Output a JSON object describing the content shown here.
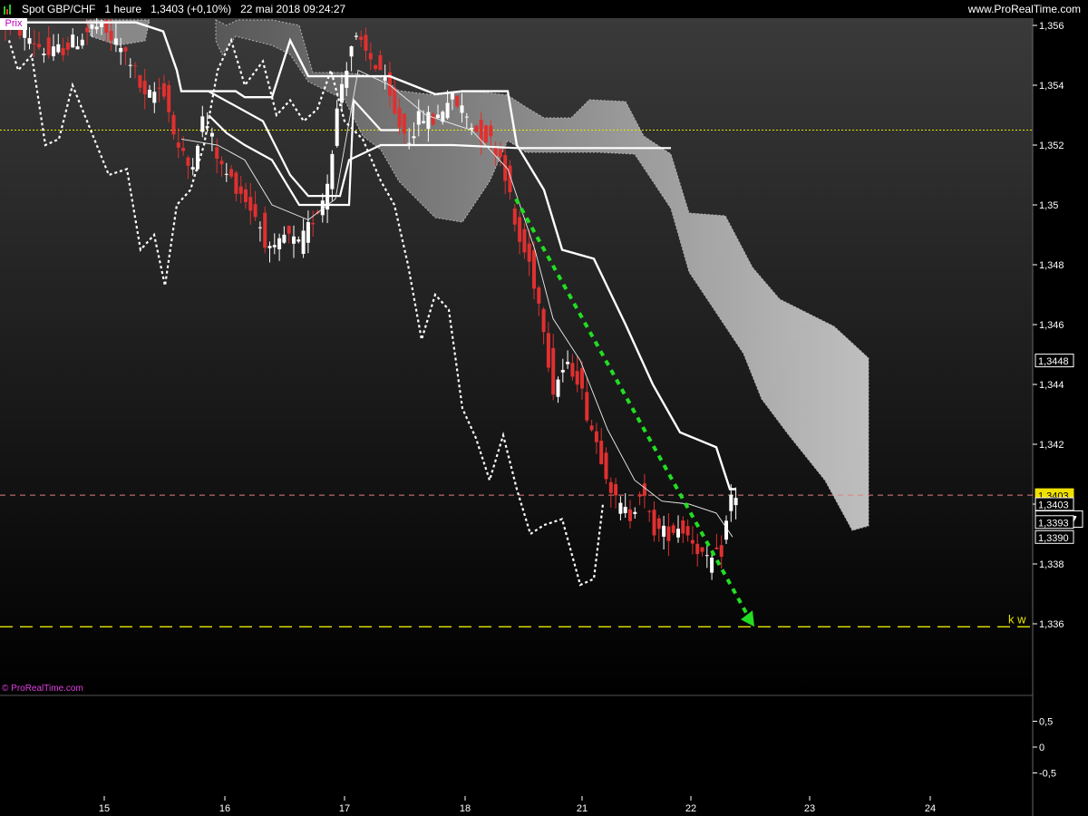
{
  "header": {
    "instrument": "Spot GBP/CHF",
    "timeframe": "1 heure",
    "quote": "1,3403 (+0,10%)",
    "datetime": "22 mai 2018 09:24:27",
    "site": "www.ProRealTime.com"
  },
  "price_tag": "Prix",
  "watermark": "© ProRealTime.com",
  "colors": {
    "up": "#ffffff",
    "down": "#e03030",
    "trend_arrow": "#22dd22",
    "ref_line": "#e6e600",
    "last_price_line": "#e08080",
    "cloud": "#9a9a9a"
  },
  "chart_data": {
    "type": "candlestick",
    "y_axis": {
      "ticks": [
        "1,356",
        "1,354",
        "1,352",
        "1,35",
        "1,348",
        "1,346",
        "1,344",
        "1,342",
        "1,34",
        "1,338",
        "1,336"
      ],
      "tick_values": [
        1.356,
        1.354,
        1.352,
        1.35,
        1.348,
        1.346,
        1.344,
        1.342,
        1.34,
        1.338,
        1.336
      ],
      "range": [
        1.3337,
        1.3565
      ]
    },
    "x_axis": {
      "ticks": [
        "15",
        "16",
        "17",
        "18",
        "21",
        "22",
        "23",
        "24"
      ]
    },
    "price_labels": [
      {
        "text": "1,3448",
        "value": 1.3448,
        "style": "box-white"
      },
      {
        "text": "1,3403",
        "value": 1.3403,
        "style": "box-yellow"
      },
      {
        "text": "1,3403",
        "value": 1.34,
        "style": "box-black"
      },
      {
        "text": "1,3397",
        "value": 1.3395,
        "style": "box-black-large"
      },
      {
        "text": "1,3393",
        "value": 1.3394,
        "style": "box-black"
      },
      {
        "text": "1,3390",
        "value": 1.3389,
        "style": "box-black"
      }
    ],
    "horizontal_lines": [
      {
        "value": 1.3525,
        "style": "dotted-yellow"
      },
      {
        "value": 1.3403,
        "style": "dashed-red"
      },
      {
        "value": 1.3359,
        "style": "dashed-yellow",
        "label": "k w"
      }
    ],
    "trend_arrow": {
      "from": [
        569,
        1.3502
      ],
      "to": [
        832,
        1.3359
      ]
    },
    "oscillator": {
      "ticks": [
        "0,5",
        "0",
        "-0,5"
      ],
      "tick_values": [
        0.5,
        0,
        -0.5
      ],
      "range": [
        -0.9,
        0.9
      ]
    }
  }
}
